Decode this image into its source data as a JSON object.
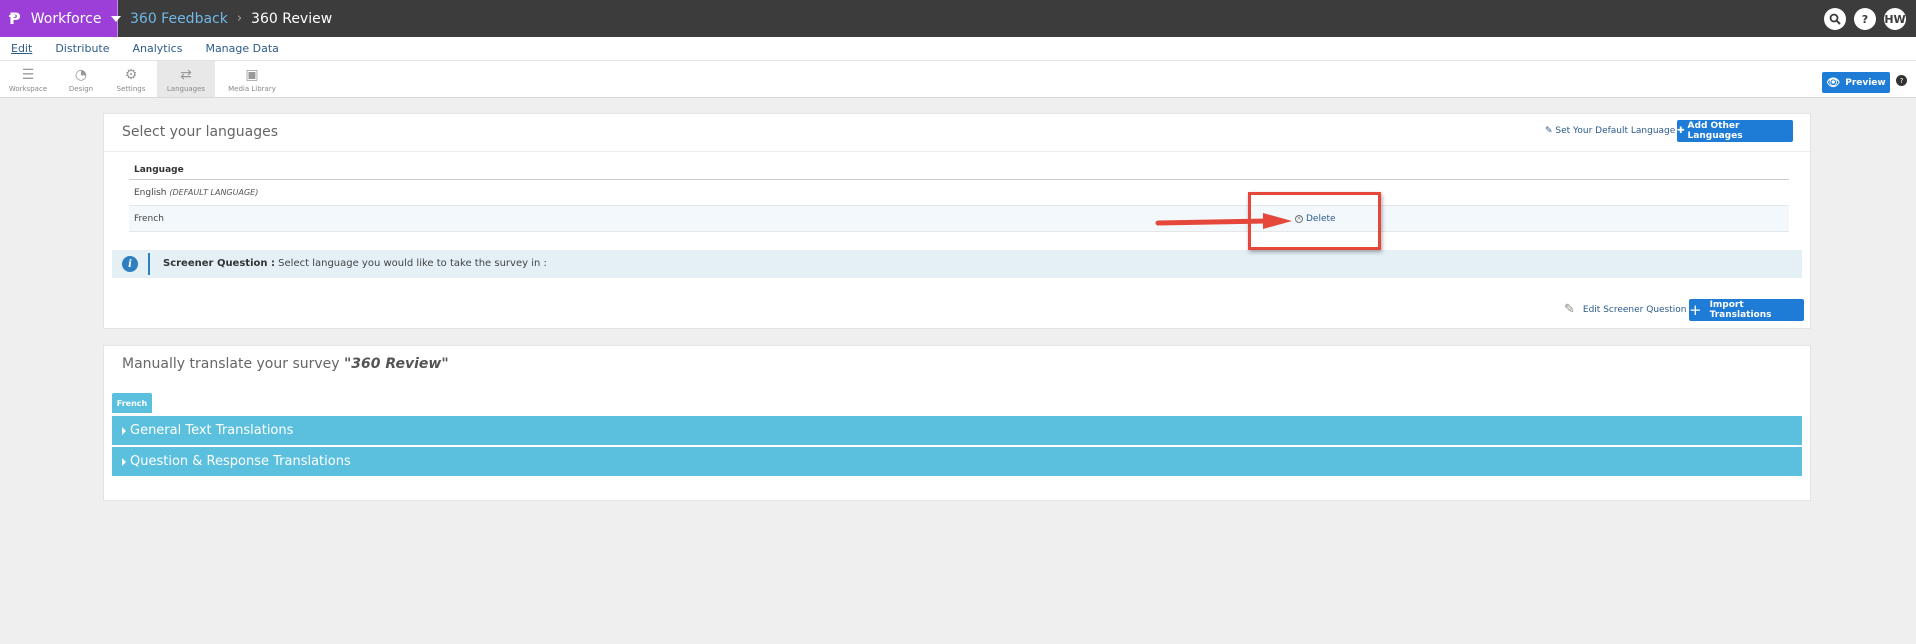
{
  "topbar": {
    "app_name": "Workforce",
    "breadcrumb_parent": "360 Feedback",
    "breadcrumb_sep": "›",
    "breadcrumb_current": "360 Review",
    "user_initials": "HW"
  },
  "nav": {
    "items": [
      {
        "label": "Edit",
        "active": true
      },
      {
        "label": "Distribute"
      },
      {
        "label": "Analytics"
      },
      {
        "label": "Manage Data"
      }
    ]
  },
  "toolbar": {
    "tools": [
      {
        "label": "Workspace",
        "icon": "workspace-icon"
      },
      {
        "label": "Design",
        "icon": "palette-icon"
      },
      {
        "label": "Settings",
        "icon": "gear-icon"
      },
      {
        "label": "Languages",
        "icon": "languages-icon",
        "active": true
      },
      {
        "label": "Media Library",
        "icon": "image-icon"
      }
    ],
    "preview_label": "Preview"
  },
  "languages": {
    "title": "Select your languages",
    "default_link": "Set Your Default Language",
    "add_button": "Add Other Languages",
    "column_header": "Language",
    "rows": [
      {
        "name": "English",
        "note": "(DEFAULT LANGUAGE)"
      },
      {
        "name": "French",
        "action": "Delete"
      }
    ],
    "screener_label": "Screener Question :",
    "screener_text": "Select language you would like to take the survey in :",
    "edit_screener": "Edit Screener Question",
    "import_button": "Import Translations"
  },
  "translate": {
    "title_prefix": "Manually translate your survey",
    "survey_name": "\"360 Review\"",
    "tab": "French",
    "sections": [
      "General Text Translations",
      "Question & Response Translations"
    ]
  },
  "colors": {
    "topbar": "#3c3c3c",
    "app_accent": "#9b3fd8",
    "primary_button": "#1e7bd6",
    "accordion": "#5bc0de",
    "annotation": "#e5473a"
  }
}
